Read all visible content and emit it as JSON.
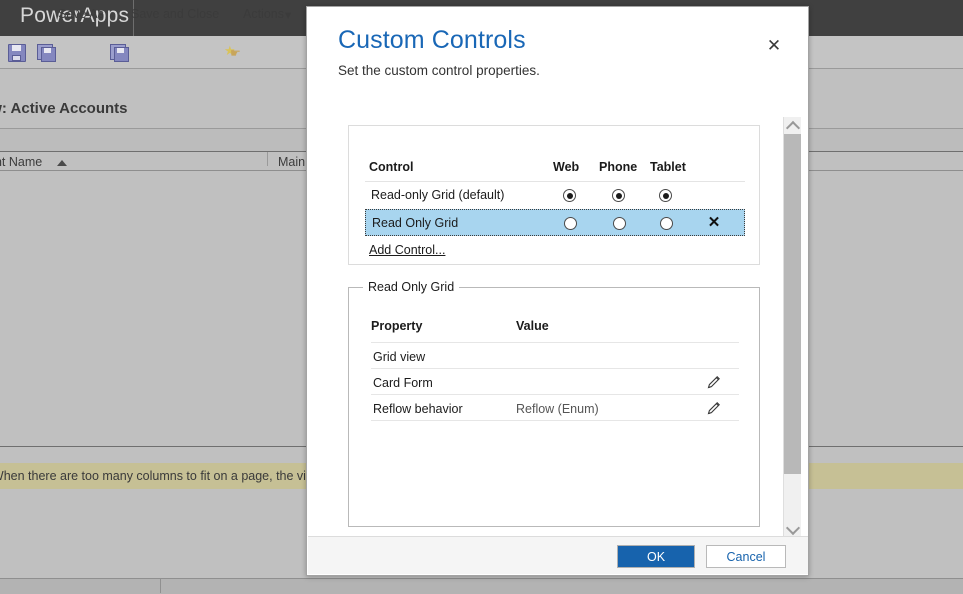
{
  "background": {
    "brand": "PowerApps",
    "toolbar": [
      {
        "label": "",
        "icon": "save-icon"
      },
      {
        "label": "Save As",
        "icon": "save-as-icon"
      },
      {
        "label": "Save and Close",
        "icon": "save-and-close-icon"
      },
      {
        "label": "Actions",
        "icon": "actions-icon",
        "caret": "▾"
      }
    ],
    "view_title": "View: Active Accounts",
    "grid_columns": [
      {
        "label": "unt Name",
        "sort": "ascending"
      },
      {
        "label": "Main"
      }
    ],
    "note_text": "e: When there are too many columns to fit on a page, the view w"
  },
  "dialog": {
    "title": "Custom Controls",
    "subtitle": "Set the custom control properties.",
    "close_label": "✕",
    "controls_table": {
      "headers": [
        "Control",
        "Web",
        "Phone",
        "Tablet"
      ],
      "rows": [
        {
          "name": "Read-only Grid (default)",
          "web": true,
          "phone": true,
          "tablet": true,
          "selected": false,
          "deletable": false
        },
        {
          "name": "Read Only Grid",
          "web": false,
          "phone": false,
          "tablet": false,
          "selected": true,
          "deletable": true,
          "delete_label": "✕"
        }
      ],
      "add_control_label": "Add Control..."
    },
    "properties_panel": {
      "legend": "Read Only Grid",
      "headers": [
        "Property",
        "Value"
      ],
      "rows": [
        {
          "property": "Grid view",
          "value": "",
          "editable": false
        },
        {
          "property": "Card Form",
          "value": "",
          "editable": true
        },
        {
          "property": "Reflow behavior",
          "value": "Reflow (Enum)",
          "editable": true
        }
      ]
    },
    "footer": {
      "ok_label": "OK",
      "cancel_label": "Cancel"
    },
    "scrollbar": {
      "up_label": "scroll-up",
      "down_label": "scroll-down"
    }
  },
  "colors": {
    "accent": "#1967b6",
    "ok_button": "#1763ad",
    "selected_row": "#a8d5ef",
    "note_bar": "#c6c095",
    "topbar": "#404040"
  }
}
